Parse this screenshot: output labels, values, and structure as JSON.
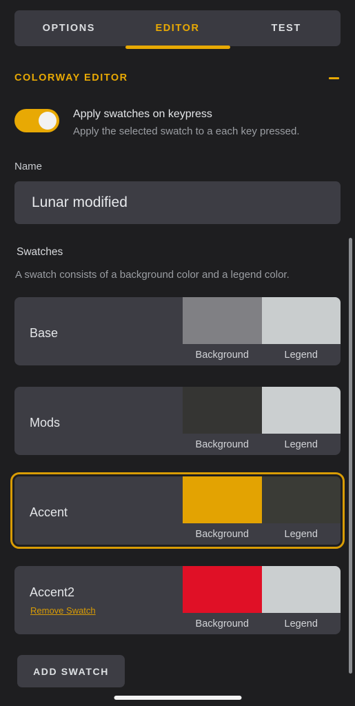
{
  "theme": {
    "page_bg": "#1e1e20",
    "card_bg": "#3d3d44",
    "tabbar_bg": "#3a3a41",
    "accent": "#e8a904",
    "text": "#e4e6e9",
    "muted_text": "#9b9ea3"
  },
  "tabs": [
    {
      "label": "OPTIONS",
      "active": false
    },
    {
      "label": "EDITOR",
      "active": true
    },
    {
      "label": "TEST",
      "active": false
    }
  ],
  "section": {
    "title": "COLORWAY EDITOR",
    "collapse_icon": "minus-icon"
  },
  "toggle": {
    "enabled": true,
    "label": "Apply swatches on keypress",
    "description": "Apply the selected swatch to a each key pressed."
  },
  "name_field": {
    "label": "Name",
    "value": "Lunar modified",
    "placeholder": "Name"
  },
  "swatches_section": {
    "heading": "Swatches",
    "description": "A swatch consists of a background color and a legend color.",
    "chip_labels": {
      "background": "Background",
      "legend": "Legend"
    },
    "remove_label": "Remove Swatch",
    "items": [
      {
        "name": "Base",
        "background_color": "#808084",
        "legend_color": "#c9cdce",
        "selected": false,
        "removable": false
      },
      {
        "name": "Mods",
        "background_color": "#353533",
        "legend_color": "#cbcfd0",
        "selected": false,
        "removable": false
      },
      {
        "name": "Accent",
        "background_color": "#e3a302",
        "legend_color": "#3a3b36",
        "selected": true,
        "removable": false
      },
      {
        "name": "Accent2",
        "background_color": "#e01026",
        "legend_color": "#cbcfd0",
        "selected": false,
        "removable": true
      }
    ]
  },
  "add_button": {
    "label": "ADD SWATCH"
  },
  "scrollbar": {
    "name": "swatch-list-scrollbar"
  }
}
